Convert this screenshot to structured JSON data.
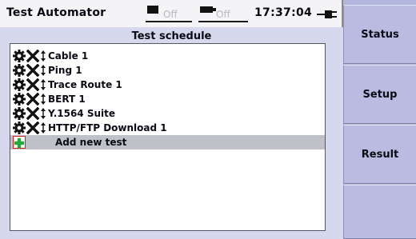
{
  "titlebar": {
    "app_title": "Test Automator",
    "battery_status": "Off",
    "link_status": "Off",
    "clock": "17:37:04"
  },
  "panel": {
    "title": "Test schedule",
    "tests": [
      {
        "label": "Cable 1"
      },
      {
        "label": "Ping 1"
      },
      {
        "label": "Trace Route 1"
      },
      {
        "label": "BERT 1"
      },
      {
        "label": "Y.1564 Suite"
      },
      {
        "label": "HTTP/FTP Download 1"
      }
    ],
    "add_label": "Add new test"
  },
  "softkeys": [
    {
      "label": "Status"
    },
    {
      "label": "Setup"
    },
    {
      "label": "Result"
    },
    {
      "label": ""
    }
  ],
  "icons": {
    "gear": "gear-icon",
    "delete": "delete-x-icon",
    "move": "move-arrows-icon",
    "add": "plus-icon",
    "power": "ac-power-icon"
  },
  "colors": {
    "panel_bg": "#d6d8ee",
    "softkey_bg": "#b9bce0",
    "selection": "#c0c0c8",
    "add_green": "#1faa3a",
    "add_border": "#d02020"
  }
}
